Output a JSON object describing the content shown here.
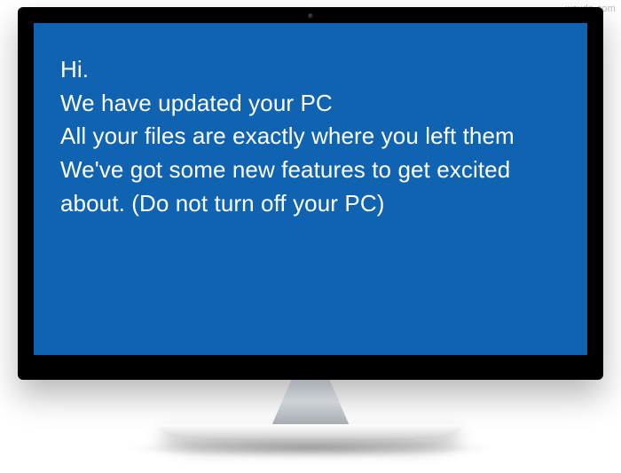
{
  "watermark": "wsxdn.com",
  "screen": {
    "background_color": "#0f63b1",
    "text_color": "#ffffff",
    "lines": [
      "Hi.",
      "We have updated your PC",
      "All your files are exactly where you left them",
      "We've got some new features to get excited about. (Do not turn off your PC)"
    ]
  }
}
